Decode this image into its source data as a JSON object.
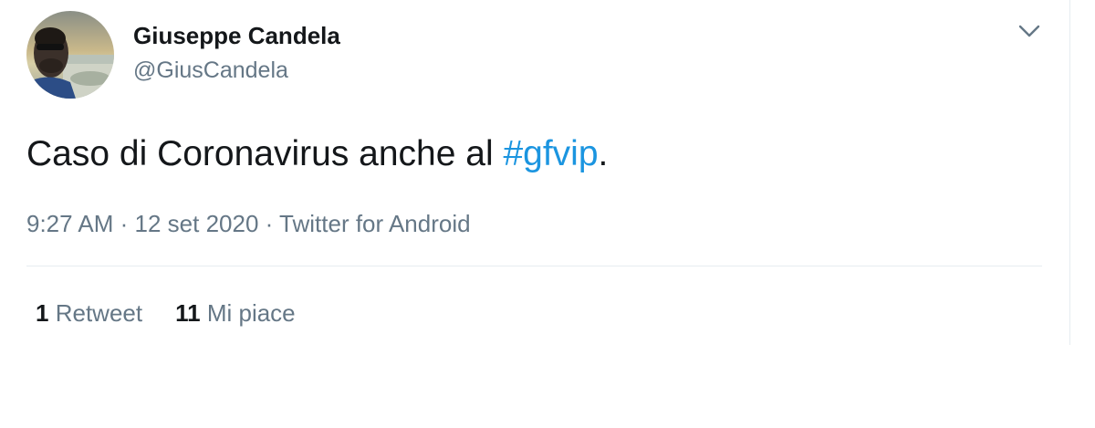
{
  "author": {
    "display_name": "Giuseppe Candela",
    "handle": "@GiusCandela"
  },
  "tweet": {
    "text_before": "Caso di Coronavirus anche al ",
    "hashtag": "#gfvip",
    "text_after": "."
  },
  "meta": {
    "time": "9:27 AM",
    "separator": " · ",
    "date": "12 set 2020",
    "source": "Twitter for Android"
  },
  "stats": {
    "retweets_count": "1",
    "retweets_label": "Retweet",
    "likes_count": "11",
    "likes_label": "Mi piace"
  },
  "icons": {
    "menu": "chevron-down-icon",
    "avatar": "profile-photo"
  },
  "colors": {
    "hashtag": "#1b95e0",
    "secondary_text": "#657786",
    "primary_text": "#14171a",
    "divider": "#e6ecf0"
  }
}
